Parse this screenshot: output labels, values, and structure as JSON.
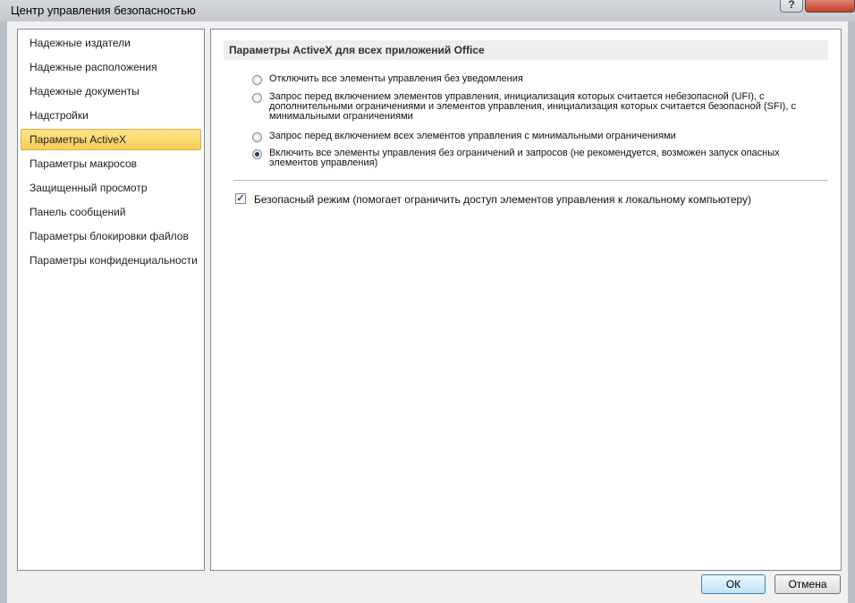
{
  "window": {
    "title": "Центр управления безопасностью",
    "help_label": "?"
  },
  "sidebar": {
    "items": [
      {
        "label": "Надежные издатели",
        "active": false
      },
      {
        "label": "Надежные расположения",
        "active": false
      },
      {
        "label": "Надежные документы",
        "active": false
      },
      {
        "label": "Надстройки",
        "active": false
      },
      {
        "label": "Параметры ActiveX",
        "active": true
      },
      {
        "label": "Параметры макросов",
        "active": false
      },
      {
        "label": "Защищенный просмотр",
        "active": false
      },
      {
        "label": "Панель сообщений",
        "active": false
      },
      {
        "label": "Параметры блокировки файлов",
        "active": false
      },
      {
        "label": "Параметры конфиденциальности",
        "active": false
      }
    ]
  },
  "main": {
    "section_title": "Параметры ActiveX для всех приложений Office",
    "options": [
      {
        "label": "Отключить все элементы управления без уведомления",
        "checked": false
      },
      {
        "label": "Запрос перед включением элементов управления, инициализация которых считается небезопасной (UFI), с дополнительными ограничениями и элементов управления, инициализация которых считается безопасной (SFI), с минимальными ограничениями",
        "checked": false
      },
      {
        "label": "Запрос перед включением всех элементов управления с минимальными ограничениями",
        "checked": false
      },
      {
        "label": "Включить все элементы управления без ограничений и запросов (не рекомендуется, возможен запуск опасных элементов управления)",
        "checked": true
      }
    ],
    "safe_mode": {
      "label": "Безопасный режим (помогает ограничить доступ элементов управления к локальному компьютеру)",
      "checked": true,
      "check_glyph": "✓"
    }
  },
  "footer": {
    "ok_label": "ОК",
    "cancel_label": "Отмена"
  }
}
